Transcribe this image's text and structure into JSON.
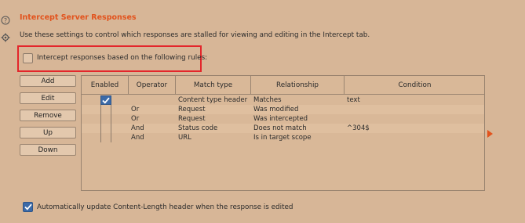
{
  "section": {
    "title": "Intercept Server Responses",
    "description": "Use these settings to control which responses are stalled for viewing and editing in the Intercept tab."
  },
  "intercept_rules": {
    "label": "Intercept responses based on the following rules:",
    "checked": false
  },
  "buttons": {
    "add": "Add",
    "edit": "Edit",
    "remove": "Remove",
    "up": "Up",
    "down": "Down"
  },
  "table": {
    "headers": {
      "enabled": "Enabled",
      "operator": "Operator",
      "match_type": "Match type",
      "relationship": "Relationship",
      "condition": "Condition"
    },
    "rows": [
      {
        "enabled": true,
        "operator": "",
        "match_type": "Content type header",
        "relationship": "Matches",
        "condition": "text"
      },
      {
        "enabled": false,
        "operator": "Or",
        "match_type": "Request",
        "relationship": "Was modified",
        "condition": ""
      },
      {
        "enabled": false,
        "operator": "Or",
        "match_type": "Request",
        "relationship": "Was intercepted",
        "condition": ""
      },
      {
        "enabled": false,
        "operator": "And",
        "match_type": "Status code",
        "relationship": "Does not match",
        "condition": "^304$"
      },
      {
        "enabled": false,
        "operator": "And",
        "match_type": "URL",
        "relationship": "Is in target scope",
        "condition": ""
      }
    ]
  },
  "auto_update": {
    "label": "Automatically update Content-Length header when the response is edited",
    "checked": true
  },
  "colors": {
    "accent": "#e2531d",
    "highlight_border": "#e3262b",
    "checkbox_checked": "#3b6aa8",
    "background": "#d7b697"
  }
}
